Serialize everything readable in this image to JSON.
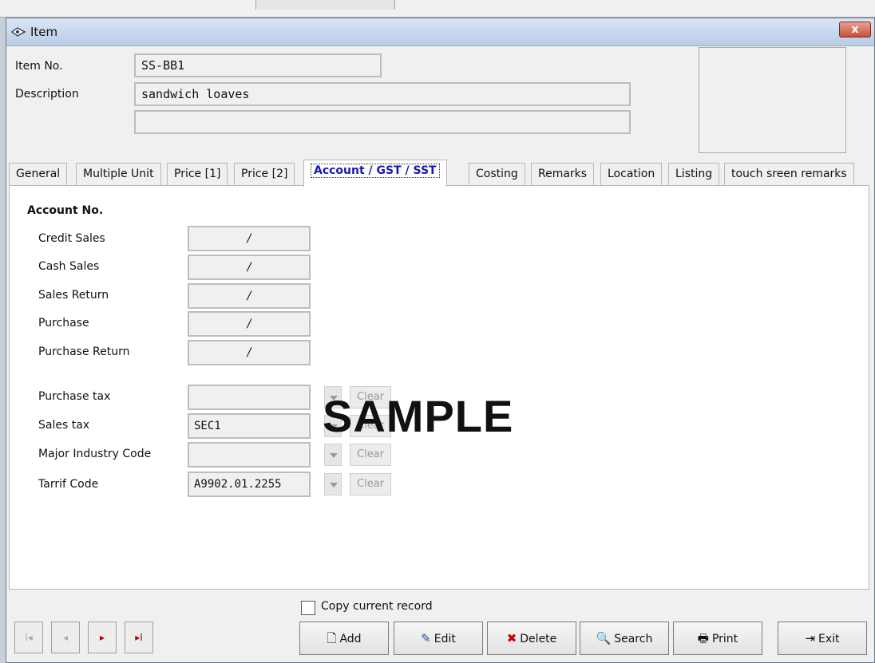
{
  "window": {
    "title": "Item",
    "close": "x"
  },
  "header": {
    "item_no_label": "Item No.",
    "item_no": "SS-BB1",
    "description_label": "Description",
    "description": "sandwich loaves",
    "description2": ""
  },
  "tabs": [
    {
      "label": "General"
    },
    {
      "label": "Multiple Unit"
    },
    {
      "label": "Price [1]"
    },
    {
      "label": "Price [2]"
    },
    {
      "label": "Account / GST / SST"
    },
    {
      "label": "Costing"
    },
    {
      "label": "Remarks"
    },
    {
      "label": "Location"
    },
    {
      "label": "Listing"
    },
    {
      "label": "touch sreen remarks"
    }
  ],
  "account": {
    "heading": "Account No.",
    "rows": [
      {
        "label": "Credit Sales",
        "value": "/"
      },
      {
        "label": "Cash Sales",
        "value": "/"
      },
      {
        "label": "Sales Return",
        "value": "/"
      },
      {
        "label": "Purchase",
        "value": "/"
      },
      {
        "label": "Purchase Return",
        "value": "/"
      }
    ]
  },
  "tax": {
    "rows": [
      {
        "label": "Purchase tax",
        "value": "",
        "clear": "Clear"
      },
      {
        "label": "Sales tax",
        "value": "SEC1",
        "clear": "Clear"
      },
      {
        "label": "Major Industry Code",
        "value": "",
        "clear": "Clear"
      },
      {
        "label": "Tarrif Code",
        "value": "A9902.01.2255",
        "clear": "Clear"
      }
    ]
  },
  "watermark": "SAMPLE",
  "footer": {
    "copy_label": "Copy current record",
    "nav": [
      "I◂",
      "◂",
      "▸",
      "▸I"
    ],
    "buttons": {
      "add": "Add",
      "edit": "Edit",
      "delete": "Delete",
      "search": "Search",
      "print": "Print",
      "exit": "Exit"
    }
  },
  "colors": {
    "active_tab": "#1a1ab0",
    "nav_active": "#b00000"
  }
}
